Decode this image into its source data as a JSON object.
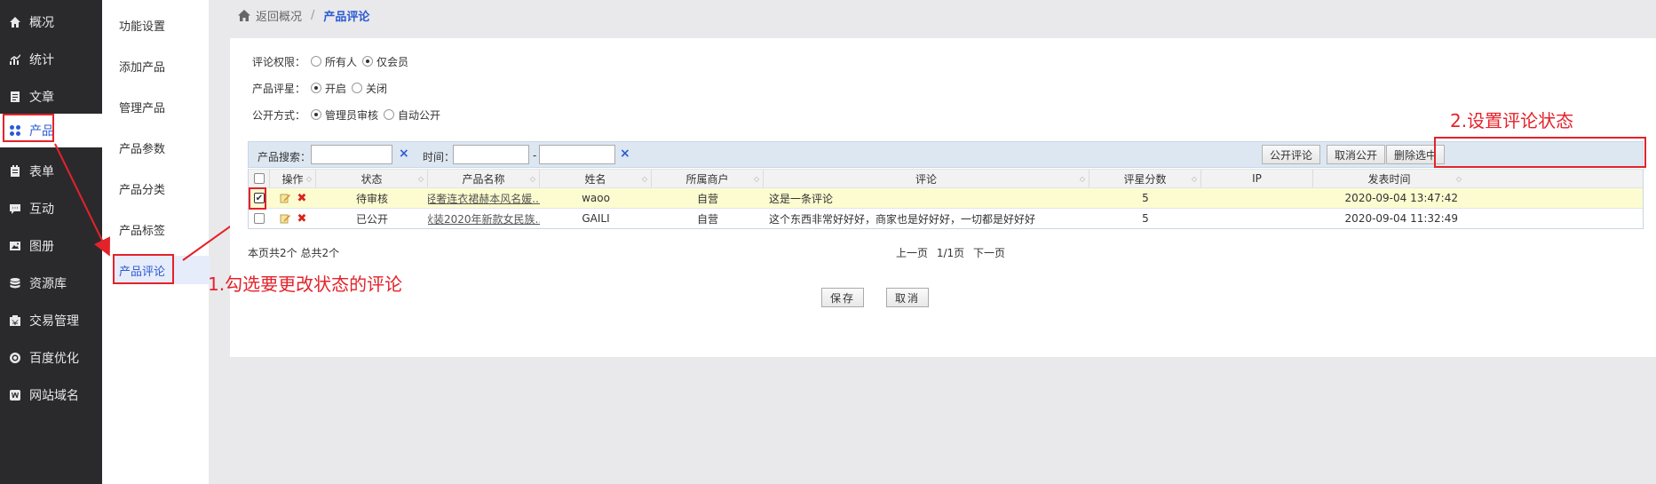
{
  "sidebar": {
    "items": [
      {
        "label": "概况",
        "icon": "home-icon"
      },
      {
        "label": "统计",
        "icon": "stats-icon"
      },
      {
        "label": "文章",
        "icon": "article-icon"
      },
      {
        "label": "产品",
        "icon": "product-icon",
        "active": true
      },
      {
        "label": "表单",
        "icon": "form-icon"
      },
      {
        "label": "互动",
        "icon": "chat-icon"
      },
      {
        "label": "图册",
        "icon": "gallery-icon"
      },
      {
        "label": "资源库",
        "icon": "database-icon"
      },
      {
        "label": "交易管理",
        "icon": "trade-icon"
      },
      {
        "label": "百度优化",
        "icon": "seo-icon"
      },
      {
        "label": "网站域名",
        "icon": "domain-icon"
      }
    ]
  },
  "submenu": {
    "items": [
      {
        "label": "功能设置"
      },
      {
        "label": "添加产品"
      },
      {
        "label": "管理产品"
      },
      {
        "label": "产品参数"
      },
      {
        "label": "产品分类"
      },
      {
        "label": "产品标签"
      },
      {
        "label": "产品评论",
        "active": true
      }
    ]
  },
  "breadcrumb": {
    "back": "返回概况",
    "separator": "/",
    "current": "产品评论"
  },
  "settings": {
    "permission": {
      "label": "评论权限：",
      "options": [
        "所有人",
        "仅会员"
      ],
      "selected": 1
    },
    "rating": {
      "label": "产品评星：",
      "options": [
        "开启",
        "关闭"
      ],
      "selected": 0
    },
    "publish": {
      "label": "公开方式：",
      "options": [
        "管理员审核",
        "自动公开"
      ],
      "selected": 0
    }
  },
  "annotations": {
    "step1": "1.勾选要更改状态的评论",
    "step2": "2.设置评论状态"
  },
  "toolbar": {
    "search_label": "产品搜索：",
    "search_value": "",
    "time_label": "时间：",
    "time_from": "",
    "time_dash": "-",
    "time_to": "",
    "clear": "×",
    "btn_publish": "公开评论",
    "btn_unpublish": "取消公开",
    "btn_delete": "删除选中"
  },
  "table": {
    "columns": [
      "操作",
      "状态",
      "产品名称",
      "姓名",
      "所属商户",
      "评论",
      "评星分数",
      "IP",
      "发表时间"
    ],
    "rows": [
      {
        "checked": true,
        "status": "待审核",
        "product": "轻奢连衣裙赫本风名媛...",
        "name": "waoo",
        "merchant": "自营",
        "comment": "这是一条评论",
        "score": "5",
        "ip": "",
        "time": "2020-09-04 13:47:42"
      },
      {
        "checked": false,
        "status": "已公开",
        "product": "秋装2020年新款女民族...",
        "name": "GAILI",
        "merchant": "自营",
        "comment": "这个东西非常好好好，商家也是好好好，一切都是好好好",
        "score": "5",
        "ip": "",
        "time": "2020-09-04 11:32:49"
      }
    ]
  },
  "footer": {
    "summary": "本页共2个 总共2个",
    "prev": "上一页",
    "page": "1/1页",
    "next": "下一页"
  },
  "actions": {
    "save": "保存",
    "cancel": "取消"
  },
  "colors": {
    "accent": "#2c5bd4",
    "annotation_red": "#e4222a",
    "sidebar_bg": "#2a2a2d",
    "selected_row": "#fcfcd0"
  }
}
